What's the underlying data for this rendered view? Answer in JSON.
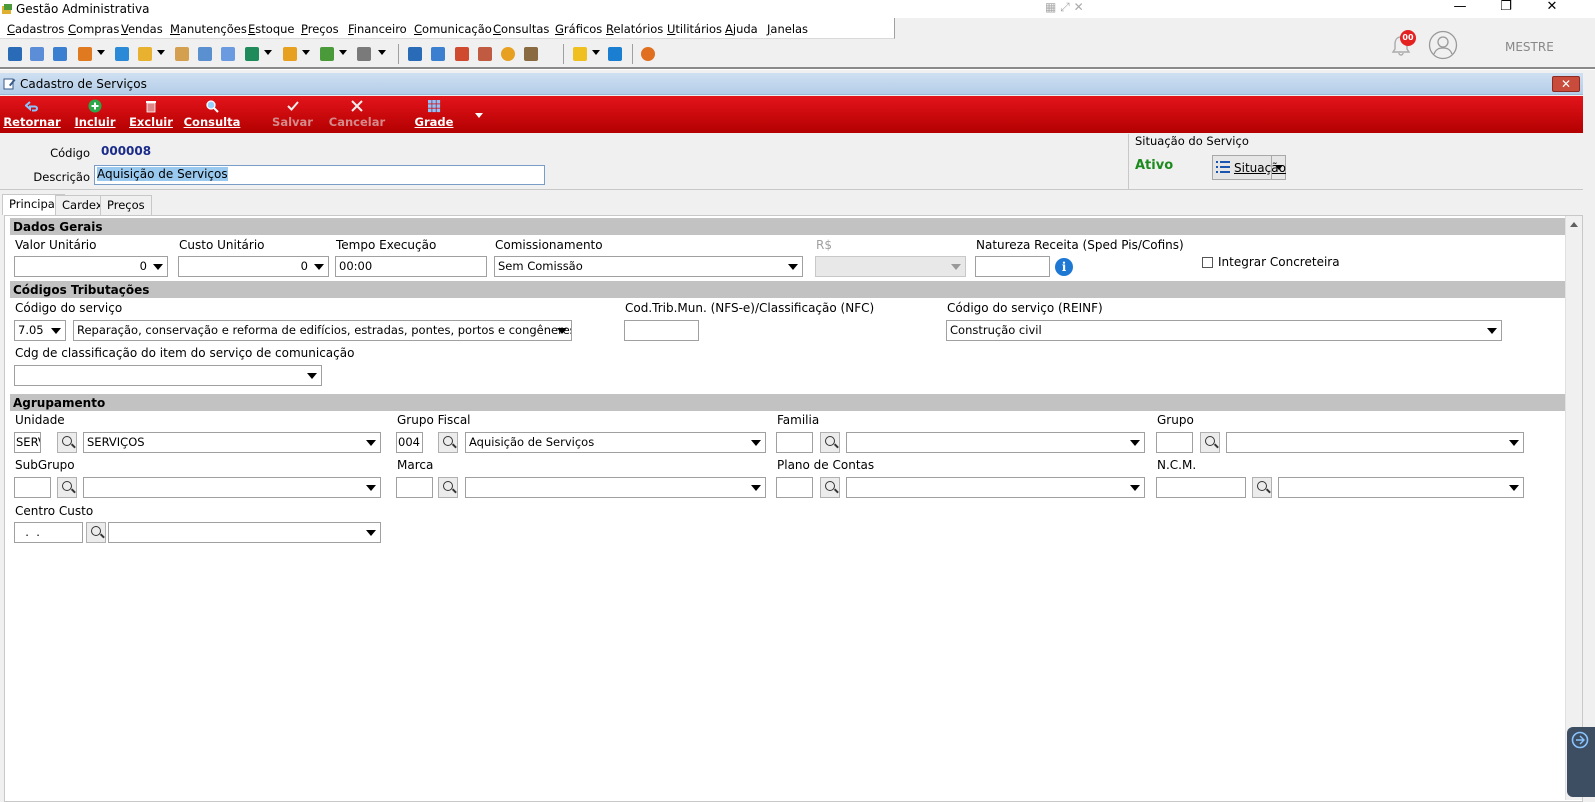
{
  "window": {
    "title": "Gestão Administrativa",
    "minimize_glyph": "—",
    "restore_glyph": "❐",
    "close_glyph": "✕"
  },
  "menu": {
    "items": [
      "Cadastros",
      "Compras",
      "Vendas",
      "Manutenções",
      "Estoque",
      "Preços",
      "Financeiro",
      "Comunicação",
      "Consultas",
      "Gráficos",
      "Relatórios",
      "Utilitários",
      "Ajuda",
      "Janelas"
    ]
  },
  "user": {
    "notifications": "00",
    "name": "MESTRE"
  },
  "form": {
    "title": "Cadastro de Serviços",
    "close_glyph": "✕"
  },
  "actions": {
    "retornar": "Retornar",
    "incluir": "Incluir",
    "excluir": "Excluir",
    "consulta": "Consulta",
    "salvar": "Salvar",
    "cancelar": "Cancelar",
    "grade": "Grade"
  },
  "header": {
    "codigo_label": "Código",
    "codigo_value": "000008",
    "descricao_label": "Descrição",
    "descricao_value": "Aquisição de Serviços",
    "situacao_title": "Situação do Serviço",
    "situacao_status": "Ativo",
    "situacao_button": "Situação"
  },
  "tabs": [
    "Principal",
    "Cardex",
    "Preços"
  ],
  "dados_gerais": {
    "section": "Dados Gerais",
    "valor_unitario_label": "Valor Unitário",
    "valor_unitario": "0",
    "custo_unitario_label": "Custo Unitário",
    "custo_unitario": "0",
    "tempo_execucao_label": "Tempo Execução",
    "tempo_execucao": "00:00",
    "comissionamento_label": "Comissionamento",
    "comissionamento": "Sem Comissão",
    "rs_label": "R$",
    "natureza_label": "Natureza Receita (Sped Pis/Cofins)",
    "integrar_label": "Integrar Concreteira"
  },
  "tributacoes": {
    "section": "Códigos Tributações",
    "codigo_servico_label": "Código do serviço",
    "codigo_servico": "7.05",
    "codigo_servico_desc": "Reparação, conservação e reforma de edifícios, estradas, pontes, portos e congêneres (exc",
    "cod_trib_label": "Cod.Trib.Mun. (NFS-e)/Classificação (NFC)",
    "reinf_label": "Código do serviço (REINF)",
    "reinf_value": "Construção civil",
    "cdg_comunicacao_label": "Cdg de classificação do item do serviço de comunicação"
  },
  "agrupamento": {
    "section": "Agrupamento",
    "unidade_label": "Unidade",
    "unidade_code": "SERV",
    "unidade_value": "SERVIÇOS",
    "grupo_fiscal_label": "Grupo Fiscal",
    "grupo_fiscal_code": "004",
    "grupo_fiscal_value": "Aquisição de Serviços",
    "familia_label": "Familia",
    "grupo_label": "Grupo",
    "subgrupo_label": "SubGrupo",
    "marca_label": "Marca",
    "plano_contas_label": "Plano de Contas",
    "ncm_label": "N.C.M.",
    "centro_custo_label": "Centro Custo",
    "centro_custo_value": "  .  ."
  }
}
